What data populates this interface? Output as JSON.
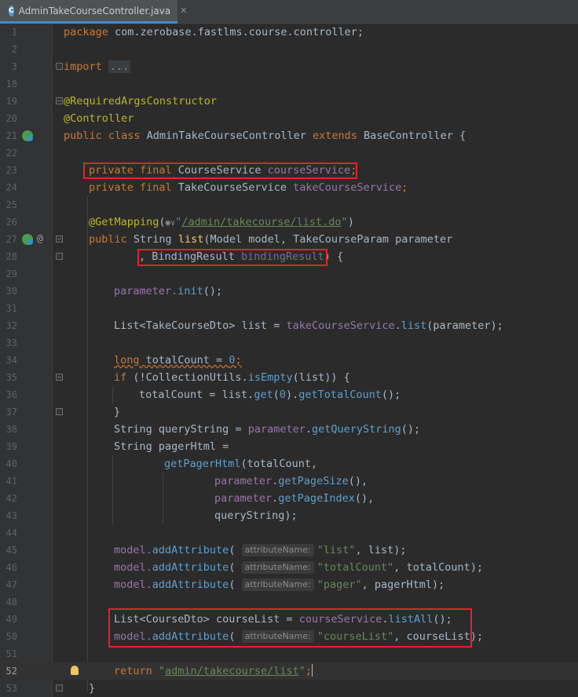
{
  "tab": {
    "icon": "java-class-icon",
    "icon_letter": "C",
    "title": "AdminTakeCourseController.java",
    "close": "✕"
  },
  "inlay_hint_label": "attributeName:",
  "lines": {
    "l1": {
      "num": "1",
      "t1": "package",
      "t2": " com.zerobase.fastlms.course.controller;"
    },
    "l2": {
      "num": "2"
    },
    "l3": {
      "num": "3",
      "t1": "import",
      "t2": " ",
      "t3": "..."
    },
    "l18": {
      "num": "18"
    },
    "l19": {
      "num": "19",
      "t1": "@RequiredArgsConstructor"
    },
    "l20": {
      "num": "20",
      "t1": "@Controller"
    },
    "l21": {
      "num": "21",
      "t1": "public class ",
      "t2": "AdminTakeCourseController",
      "t3": " extends ",
      "t4": "BaseController {"
    },
    "l22": {
      "num": "22"
    },
    "l23": {
      "num": "23",
      "t1": "private final ",
      "t2": "CourseService ",
      "t3": "courseService",
      "t4": ";"
    },
    "l24": {
      "num": "24",
      "t1": "private final ",
      "t2": "TakeCourseService ",
      "t3": "takeCourseService",
      "t4": ";"
    },
    "l25": {
      "num": "25"
    },
    "l26": {
      "num": "26",
      "t1": "@GetMapping",
      "t2": "(",
      "t3": "◉",
      "t4": "∨",
      "t5": "\"",
      "t6": "/admin/takecourse/list.do",
      "t7": "\"",
      "t8": ")"
    },
    "l27": {
      "num": "27",
      "t1": "public ",
      "t2": "String ",
      "t3": "list",
      "t4": "(Model model, TakeCourseParam parameter"
    },
    "l28": {
      "num": "28",
      "t1": ", BindingResult ",
      "t2": "bindingResult",
      "t3": ") {"
    },
    "l29": {
      "num": "29"
    },
    "l30": {
      "num": "30",
      "t1": "parameter.",
      "t2": "init",
      "t3": "();"
    },
    "l31": {
      "num": "31"
    },
    "l32": {
      "num": "32",
      "t1": "List<TakeCourseDto> list = ",
      "t2": "takeCourseService",
      "t3": ".",
      "t4": "list",
      "t5": "(parameter);"
    },
    "l33": {
      "num": "33"
    },
    "l34": {
      "num": "34",
      "t1": "long",
      "t2": " totalCount = ",
      "t3": "0",
      "t4": ";"
    },
    "l35": {
      "num": "35",
      "t1": "if",
      "t2": " (!CollectionUtils.",
      "t3": "isEmpty",
      "t4": "(list)) {"
    },
    "l36": {
      "num": "36",
      "t1": "totalCount = list.",
      "t2": "get",
      "t3": "(",
      "t4": "0",
      "t5": ").",
      "t6": "getTotalCount",
      "t7": "();"
    },
    "l37": {
      "num": "37",
      "t1": "}"
    },
    "l38": {
      "num": "38",
      "t1": "String ",
      "t2": "queryString = ",
      "t3": "parameter",
      "t4": ".",
      "t5": "getQueryString",
      "t6": "();"
    },
    "l39": {
      "num": "39",
      "t1": "String ",
      "t2": "pagerHtml ="
    },
    "l40": {
      "num": "40",
      "t1": "getPagerHtml",
      "t2": "(totalCount,"
    },
    "l41": {
      "num": "41",
      "t1": "parameter",
      "t2": ".",
      "t3": "getPageSize",
      "t4": "(),"
    },
    "l42": {
      "num": "42",
      "t1": "parameter",
      "t2": ".",
      "t3": "getPageIndex",
      "t4": "(),"
    },
    "l43": {
      "num": "43",
      "t1": "queryString);"
    },
    "l44": {
      "num": "44"
    },
    "l45": {
      "num": "45",
      "t1": "model.",
      "t2": "addAttribute",
      "t3": "( ",
      "t4": "\"list\"",
      "t5": ", list);"
    },
    "l46": {
      "num": "46",
      "t1": "model.",
      "t2": "addAttribute",
      "t3": "( ",
      "t4": "\"totalCount\"",
      "t5": ", totalCount);"
    },
    "l47": {
      "num": "47",
      "t1": "model.",
      "t2": "addAttribute",
      "t3": "( ",
      "t4": "\"pager\"",
      "t5": ", pagerHtml);"
    },
    "l48": {
      "num": "48"
    },
    "l49": {
      "num": "49",
      "t1": "List<CourseDto> courseList = ",
      "t2": "courseService",
      "t3": ".",
      "t4": "listAll",
      "t5": "();"
    },
    "l50": {
      "num": "50",
      "t1": "model.",
      "t2": "addAttribute",
      "t3": "( ",
      "t4": "\"courseList\"",
      "t5": ", courseList);"
    },
    "l51": {
      "num": "51"
    },
    "l52": {
      "num": "52",
      "t1": "return ",
      "t2": "\"",
      "t3": "admin/takecourse/list",
      "t4": "\"",
      "t5": ";"
    },
    "l53": {
      "num": "53",
      "t1": "}"
    }
  },
  "colors": {
    "highlight_box": "#e0242b",
    "keyword": "#cc7832",
    "annotation": "#bbb529",
    "string": "#6a8759",
    "field": "#9876aa",
    "method_decl": "#ffc66d"
  }
}
